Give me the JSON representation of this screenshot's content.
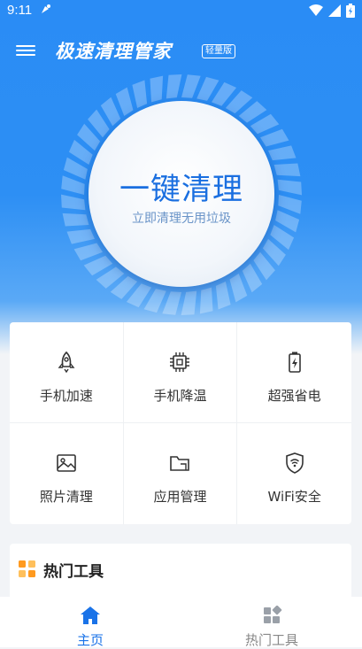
{
  "status_bar": {
    "time": "9:11"
  },
  "app": {
    "title": "极速清理管家",
    "badge": "轻量版"
  },
  "clean": {
    "title": "一键清理",
    "subtitle": "立即清理无用垃圾"
  },
  "tools": [
    {
      "label": "手机加速",
      "icon": "rocket-icon"
    },
    {
      "label": "手机降温",
      "icon": "chip-icon"
    },
    {
      "label": "超强省电",
      "icon": "battery-charge-icon"
    },
    {
      "label": "照片清理",
      "icon": "image-icon"
    },
    {
      "label": "应用管理",
      "icon": "folder-icon"
    },
    {
      "label": "WiFi安全",
      "icon": "wifi-shield-icon"
    }
  ],
  "hot_tools": {
    "title": "热门工具"
  },
  "tabbar": [
    {
      "label": "主页",
      "icon": "home-icon",
      "active": true
    },
    {
      "label": "热门工具",
      "icon": "grid-icon",
      "active": false
    }
  ],
  "colors": {
    "primary": "#2a8cf5",
    "active_tab": "#1a73e8",
    "inactive_tab": "#888888",
    "hot_icon": "#ff9a1f"
  }
}
